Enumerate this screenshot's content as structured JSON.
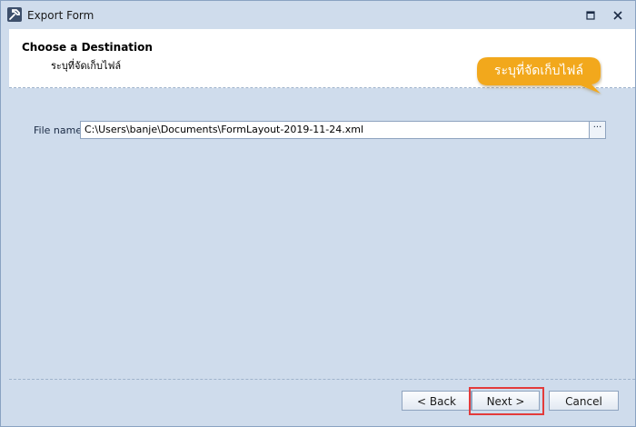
{
  "window": {
    "title": "Export Form",
    "icon": "app-tool-icon",
    "controls": [
      "restore-icon",
      "close-icon"
    ]
  },
  "header": {
    "title": "Choose a Destination",
    "subtitle": "ระบุที่จัดเก็บไฟล์"
  },
  "callout": {
    "text": "ระบุที่จัดเก็บไฟล์",
    "color": "#f2a81d"
  },
  "form": {
    "file_label": "File name",
    "file_value": "C:\\Users\\banje\\Documents\\FormLayout-2019-11-24.xml",
    "browse_label": "···"
  },
  "footer": {
    "back_label": "< Back",
    "next_label": "Next >",
    "cancel_label": "Cancel"
  },
  "colors": {
    "background": "#cfdcec",
    "highlight": "#e33b3b"
  }
}
